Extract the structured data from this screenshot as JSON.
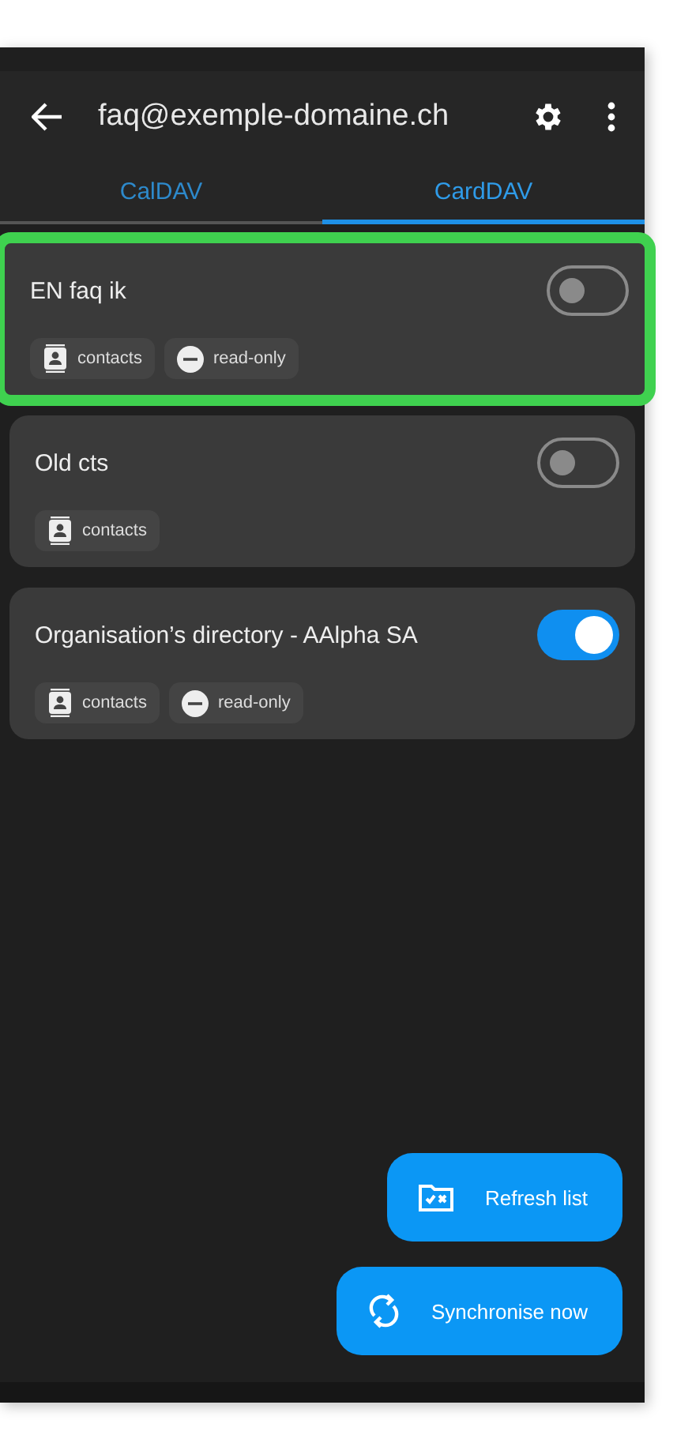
{
  "app_bar": {
    "title": "faq@exemple-domaine.ch"
  },
  "tabs": [
    {
      "label": "CalDAV",
      "selected": false
    },
    {
      "label": "CardDAV",
      "selected": true
    }
  ],
  "collections": [
    {
      "name": "EN faq ik",
      "on": false,
      "highlighted": true,
      "tags": [
        {
          "kind": "contacts",
          "label": "contacts"
        },
        {
          "kind": "read_only",
          "label": "read-only"
        }
      ]
    },
    {
      "name": "Old cts",
      "on": false,
      "highlighted": false,
      "tags": [
        {
          "kind": "contacts",
          "label": "contacts"
        }
      ]
    },
    {
      "name": "Organisation’s directory - AAlpha SA",
      "on": true,
      "highlighted": false,
      "tags": [
        {
          "kind": "contacts",
          "label": "contacts"
        },
        {
          "kind": "read_only",
          "label": "read-only"
        }
      ]
    }
  ],
  "actions": [
    {
      "kind": "refresh",
      "label": "Refresh list"
    },
    {
      "kind": "sync",
      "label": "Synchronise now"
    }
  ]
}
